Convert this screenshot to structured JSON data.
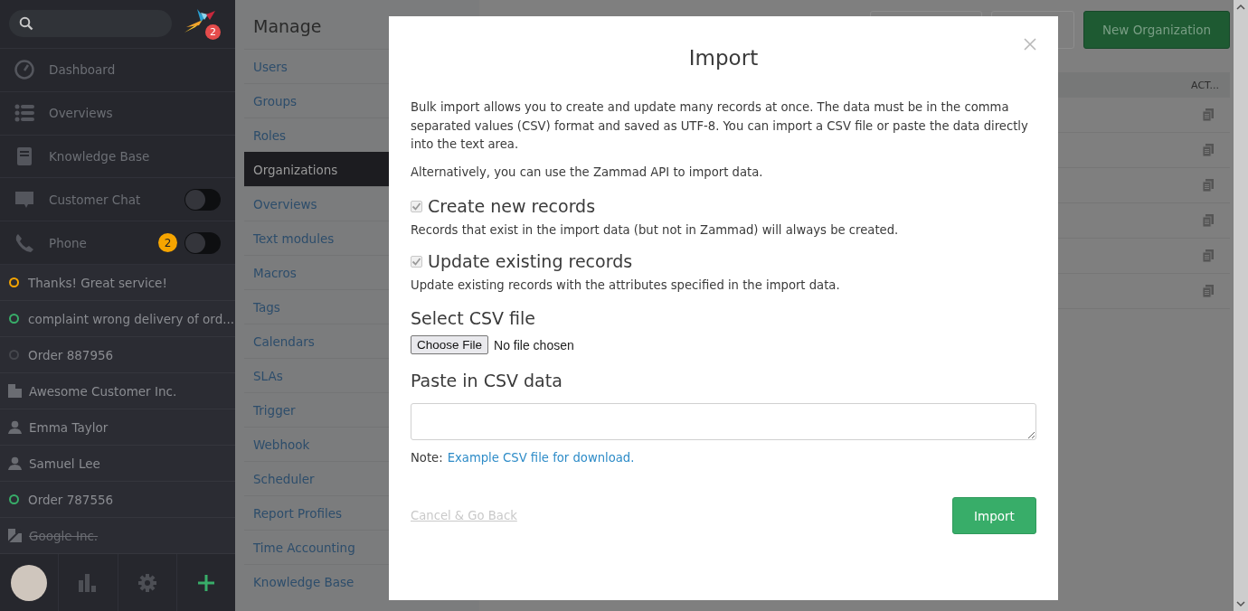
{
  "sidebar": {
    "logo_badge": "2",
    "nav": [
      {
        "label": "Dashboard",
        "kind": "link"
      },
      {
        "label": "Overviews",
        "kind": "link"
      },
      {
        "label": "Knowledge Base",
        "kind": "link"
      },
      {
        "label": "Customer Chat",
        "kind": "toggle",
        "on": false
      },
      {
        "label": "Phone",
        "kind": "toggle",
        "on": false,
        "badge": "2"
      }
    ],
    "tasks": [
      {
        "label": "Thanks! Great service!",
        "kind": "ticket",
        "color": "#f6a500",
        "inactive": false
      },
      {
        "label": "complaint wrong delivery of ord...",
        "kind": "ticket",
        "color": "#38ad69",
        "inactive": false
      },
      {
        "label": "Order 887956",
        "kind": "ticket",
        "color": "#45474d",
        "inactive": false
      },
      {
        "label": "Awesome Customer Inc.",
        "kind": "organization",
        "inactive": false
      },
      {
        "label": "Emma Taylor",
        "kind": "user",
        "inactive": false
      },
      {
        "label": "Samuel Lee",
        "kind": "user",
        "inactive": false
      },
      {
        "label": "Order 787556",
        "kind": "ticket",
        "color": "#38ad69",
        "inactive": false
      },
      {
        "label": "Google Inc.",
        "kind": "organization",
        "inactive": true
      }
    ]
  },
  "manage": {
    "title": "Manage",
    "items": [
      {
        "label": "Users",
        "selected": false
      },
      {
        "label": "Groups",
        "selected": false
      },
      {
        "label": "Roles",
        "selected": false
      },
      {
        "label": "Organizations",
        "selected": true
      },
      {
        "label": "Overviews",
        "selected": false
      },
      {
        "label": "Text modules",
        "selected": false
      },
      {
        "label": "Macros",
        "selected": false
      },
      {
        "label": "Tags",
        "selected": false
      },
      {
        "label": "Calendars",
        "selected": false
      },
      {
        "label": "SLAs",
        "selected": false
      },
      {
        "label": "Trigger",
        "selected": false
      },
      {
        "label": "Webhook",
        "selected": false
      },
      {
        "label": "Scheduler",
        "selected": false
      },
      {
        "label": "Report Profiles",
        "selected": false
      },
      {
        "label": "Time Accounting",
        "selected": false
      },
      {
        "label": "Knowledge Base",
        "selected": false
      }
    ]
  },
  "main": {
    "new_button": "New Organization",
    "table": {
      "columns": [
        {
          "label": "ACT..."
        }
      ]
    }
  },
  "modal": {
    "title": "Import",
    "paragraphs": [
      "Bulk import allows you to create and update many records at once. The data must be in the comma separated values (CSV) format and saved as UTF-8. You can import a CSV file or paste the data directly into the text area.",
      "Alternatively, you can use the Zammad API to import data."
    ],
    "options": [
      {
        "label": "Create new records",
        "description": "Records that exist in the import data (but not in Zammad) will always be created.",
        "checked": true,
        "disabled": true
      },
      {
        "label": "Update existing records",
        "description": "Update existing records with the attributes specified in the import data.",
        "checked": true,
        "disabled": true
      }
    ],
    "file": {
      "heading": "Select CSV file",
      "button": "Choose File",
      "status": "No file chosen"
    },
    "paste": {
      "heading": "Paste in CSV data"
    },
    "note": {
      "prefix": "Note:",
      "link": "Example CSV file for download."
    },
    "cancel": "Cancel & Go Back",
    "submit": "Import"
  }
}
